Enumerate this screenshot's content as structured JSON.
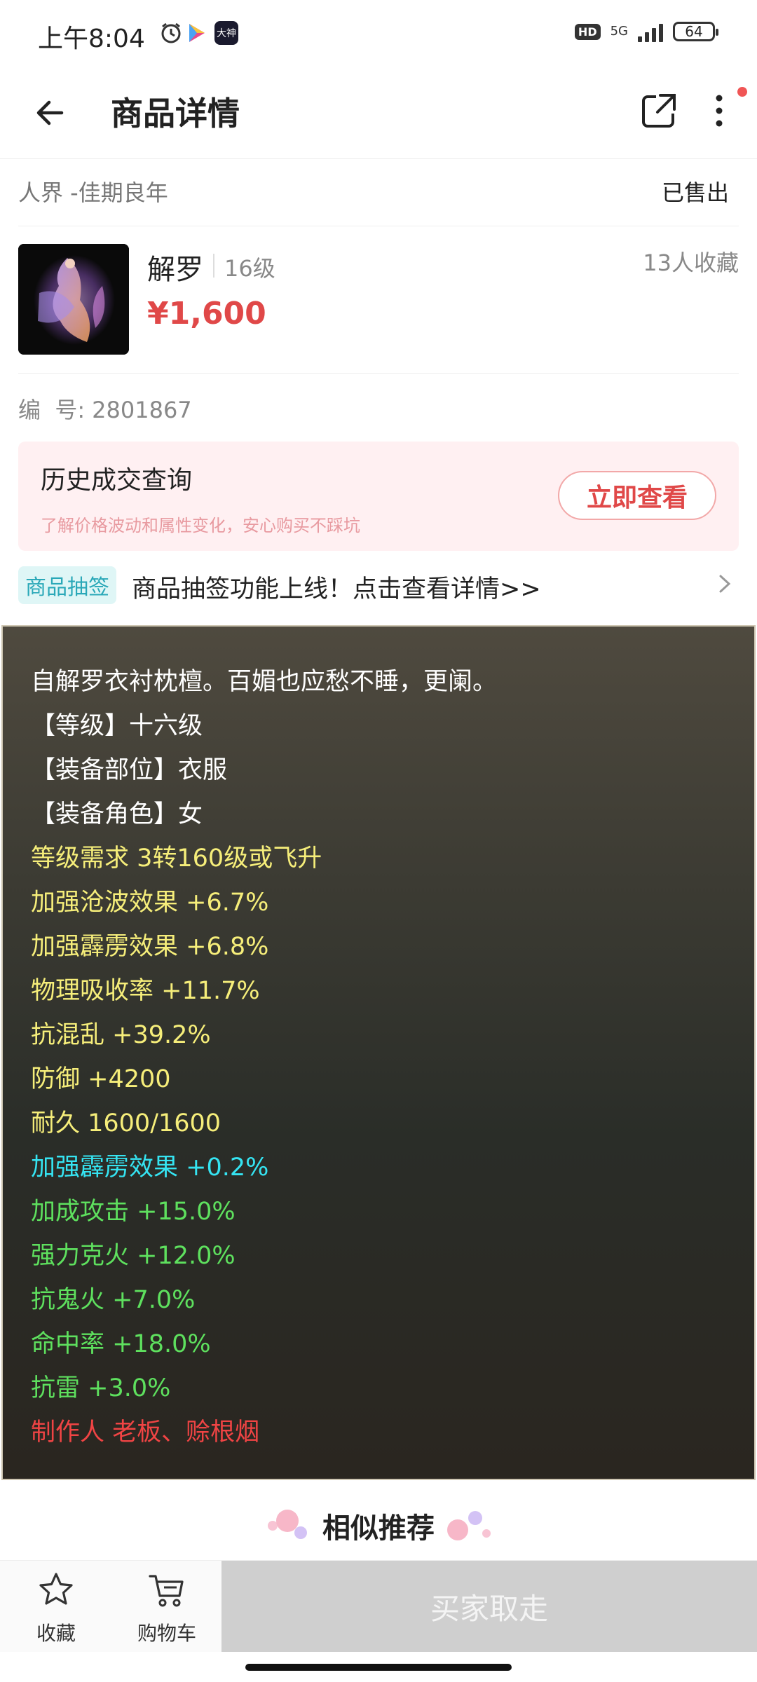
{
  "status_bar": {
    "time": "上午8:04",
    "app_badge": "大神",
    "hd_label": "HD",
    "network": "5G",
    "battery": "64"
  },
  "nav": {
    "title": "商品详情"
  },
  "server": {
    "name": "人界 -佳期良年",
    "status": "已售出"
  },
  "product": {
    "name": "解罗",
    "level": "16级",
    "favorites": "13人收藏",
    "price": "¥1,600",
    "id_label": "编  号:",
    "id_value": "2801867"
  },
  "history": {
    "title": "历史成交查询",
    "desc": "了解价格波动和属性变化，安心购买不踩坑",
    "button": "立即查看"
  },
  "lottery": {
    "tag": "商品抽签",
    "text": "商品抽签功能上线！点击查看详情>>"
  },
  "attributes": [
    {
      "text": "自解罗衣衬枕檀。百媚也应愁不睡，更阑。",
      "color": "#ffffff"
    },
    {
      "text": "【等级】十六级",
      "color": "#ffffff"
    },
    {
      "text": "【装备部位】衣服",
      "color": "#ffffff"
    },
    {
      "text": "【装备角色】女",
      "color": "#ffffff"
    },
    {
      "text": "等级需求 3转160级或飞升",
      "color": "#f6ee7a"
    },
    {
      "text": "加强沧波效果 +6.7%",
      "color": "#f6ee7a"
    },
    {
      "text": "加强霹雳效果 +6.8%",
      "color": "#f6ee7a"
    },
    {
      "text": "物理吸收率 +11.7%",
      "color": "#f6ee7a"
    },
    {
      "text": "抗混乱 +39.2%",
      "color": "#f6ee7a"
    },
    {
      "text": "防御 +4200",
      "color": "#f6ee7a"
    },
    {
      "text": "耐久 1600/1600",
      "color": "#f6ee7a"
    },
    {
      "text": "加强霹雳效果 +0.2%",
      "color": "#35e4f2"
    },
    {
      "text": "加成攻击 +15.0%",
      "color": "#5ee05e"
    },
    {
      "text": "强力克火 +12.0%",
      "color": "#5ee05e"
    },
    {
      "text": "抗鬼火 +7.0%",
      "color": "#5ee05e"
    },
    {
      "text": "命中率 +18.0%",
      "color": "#5ee05e"
    },
    {
      "text": "抗雷 +3.0%",
      "color": "#5ee05e"
    },
    {
      "text": "制作人 老板、赊根烟",
      "color": "#f04444"
    }
  ],
  "similar": {
    "title": "相似推荐"
  },
  "bottom": {
    "favorite_label": "收藏",
    "cart_label": "购物车",
    "buy_label": "买家取走"
  },
  "colors": {
    "price_red": "#e04848",
    "tag_cyan": "#2aa8b8",
    "history_bg": "#fff0f2"
  }
}
